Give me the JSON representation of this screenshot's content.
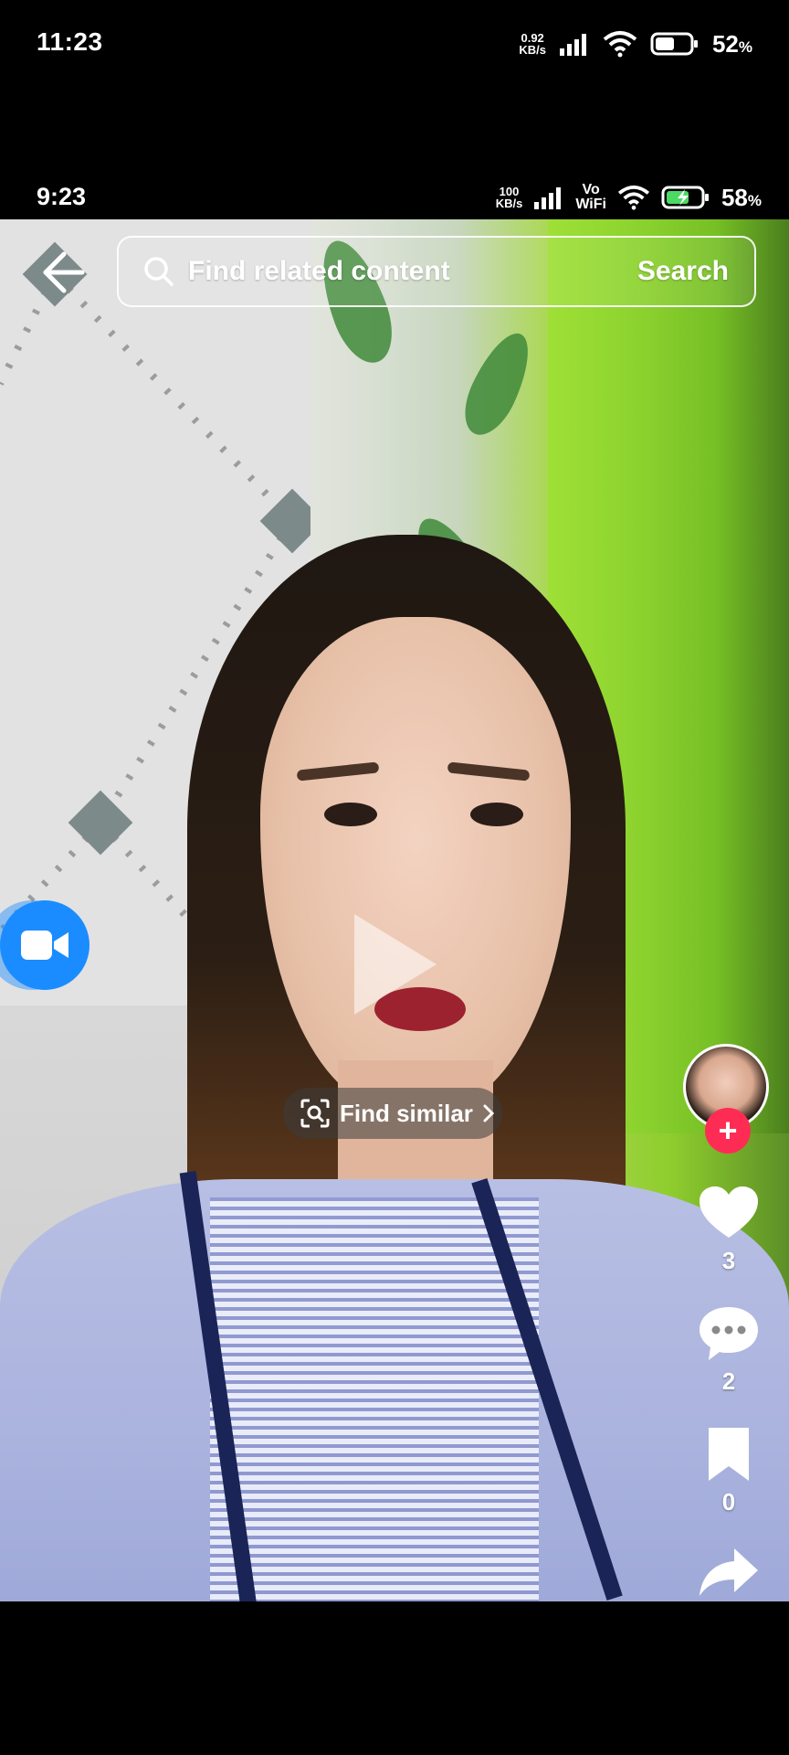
{
  "outer_status": {
    "time": "11:23",
    "net_speed_value": "0.92",
    "net_speed_unit": "KB/s",
    "battery_value": "52",
    "battery_unit": "%"
  },
  "inner_status": {
    "time": "9:23",
    "net_speed_value": "100",
    "net_speed_unit": "KB/s",
    "vo_label": "Vo",
    "wifi_label": "WiFi",
    "battery_value": "58",
    "battery_unit": "%"
  },
  "search": {
    "placeholder": "Find related content",
    "action_label": "Search"
  },
  "find_similar": {
    "label": "Find similar"
  },
  "actions": {
    "follow_label": "+",
    "likes": "3",
    "comments": "2",
    "bookmarks": "0"
  },
  "icons": {
    "back": "back-arrow-icon",
    "search": "search-icon",
    "video_call": "video-camera-icon",
    "play": "play-icon",
    "scan": "scan-icon",
    "like": "heart-icon",
    "comment": "comment-icon",
    "bookmark": "bookmark-icon",
    "share": "share-icon"
  },
  "colors": {
    "follow_accent": "#fe2c55",
    "float_button": "#1a8cff"
  }
}
